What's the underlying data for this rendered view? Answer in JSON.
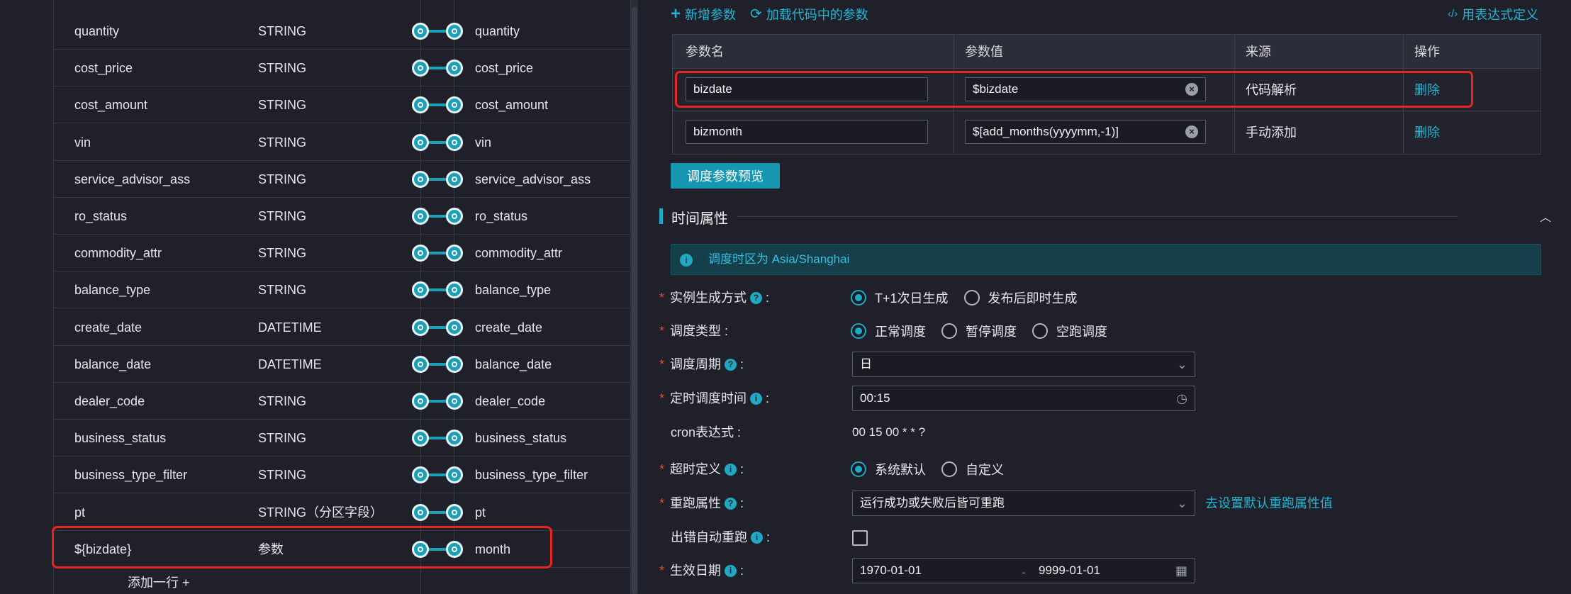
{
  "mapping": {
    "rows": [
      {
        "source": "quantity",
        "type": "STRING",
        "target": "quantity"
      },
      {
        "source": "cost_price",
        "type": "STRING",
        "target": "cost_price"
      },
      {
        "source": "cost_amount",
        "type": "STRING",
        "target": "cost_amount"
      },
      {
        "source": "vin",
        "type": "STRING",
        "target": "vin"
      },
      {
        "source": "service_advisor_ass",
        "type": "STRING",
        "target": "service_advisor_ass"
      },
      {
        "source": "ro_status",
        "type": "STRING",
        "target": "ro_status"
      },
      {
        "source": "commodity_attr",
        "type": "STRING",
        "target": "commodity_attr"
      },
      {
        "source": "balance_type",
        "type": "STRING",
        "target": "balance_type"
      },
      {
        "source": "create_date",
        "type": "DATETIME",
        "target": "create_date"
      },
      {
        "source": "balance_date",
        "type": "DATETIME",
        "target": "balance_date"
      },
      {
        "source": "dealer_code",
        "type": "STRING",
        "target": "dealer_code"
      },
      {
        "source": "business_status",
        "type": "STRING",
        "target": "business_status"
      },
      {
        "source": "business_type_filter",
        "type": "STRING",
        "target": "business_type_filter"
      },
      {
        "source": "pt",
        "type": "STRING（分区字段）",
        "target": "pt"
      },
      {
        "source": "${bizdate}",
        "type": "参数",
        "target": "month"
      }
    ],
    "add_row_label": "添加一行 +"
  },
  "toolbar": {
    "add_param": "新增参数",
    "load_params": "加载代码中的参数",
    "expression": "用表达式定义"
  },
  "param_table": {
    "headers": [
      "参数名",
      "参数值",
      "来源",
      "操作"
    ],
    "rows": [
      {
        "name": "bizdate",
        "value": "$bizdate",
        "source": "代码解析",
        "action": "删除"
      },
      {
        "name": "bizmonth",
        "value": "$[add_months(yyyymm,-1)]",
        "source": "手动添加",
        "action": "删除"
      }
    ]
  },
  "preview_button": "调度参数预览",
  "time_section": {
    "title": "时间属性",
    "info": "调度时区为 Asia/Shanghai",
    "instance_mode": {
      "label": "实例生成方式",
      "options": [
        "T+1次日生成",
        "发布后即时生成"
      ],
      "selected": "T+1次日生成"
    },
    "schedule_type": {
      "label": "调度类型",
      "options": [
        "正常调度",
        "暂停调度",
        "空跑调度"
      ],
      "selected": "正常调度"
    },
    "period": {
      "label": "调度周期",
      "value": "日"
    },
    "time": {
      "label": "定时调度时间",
      "value": "00:15"
    },
    "cron": {
      "label": "cron表达式 :",
      "value": "00 15 00 * * ?"
    },
    "timeout": {
      "label": "超时定义",
      "options": [
        "系统默认",
        "自定义"
      ],
      "selected": "系统默认"
    },
    "rerun": {
      "label": "重跑属性",
      "value": "运行成功或失败后皆可重跑",
      "link": "去设置默认重跑属性值"
    },
    "auto_rerun": {
      "label": "出错自动重跑",
      "checked": false
    },
    "effective": {
      "label": "生效日期",
      "start": "1970-01-01",
      "sep": "-",
      "end": "9999-01-01"
    }
  },
  "colors": {
    "accent": "#1fa9c5",
    "highlight": "#e8241e",
    "background": "#1f2029"
  }
}
